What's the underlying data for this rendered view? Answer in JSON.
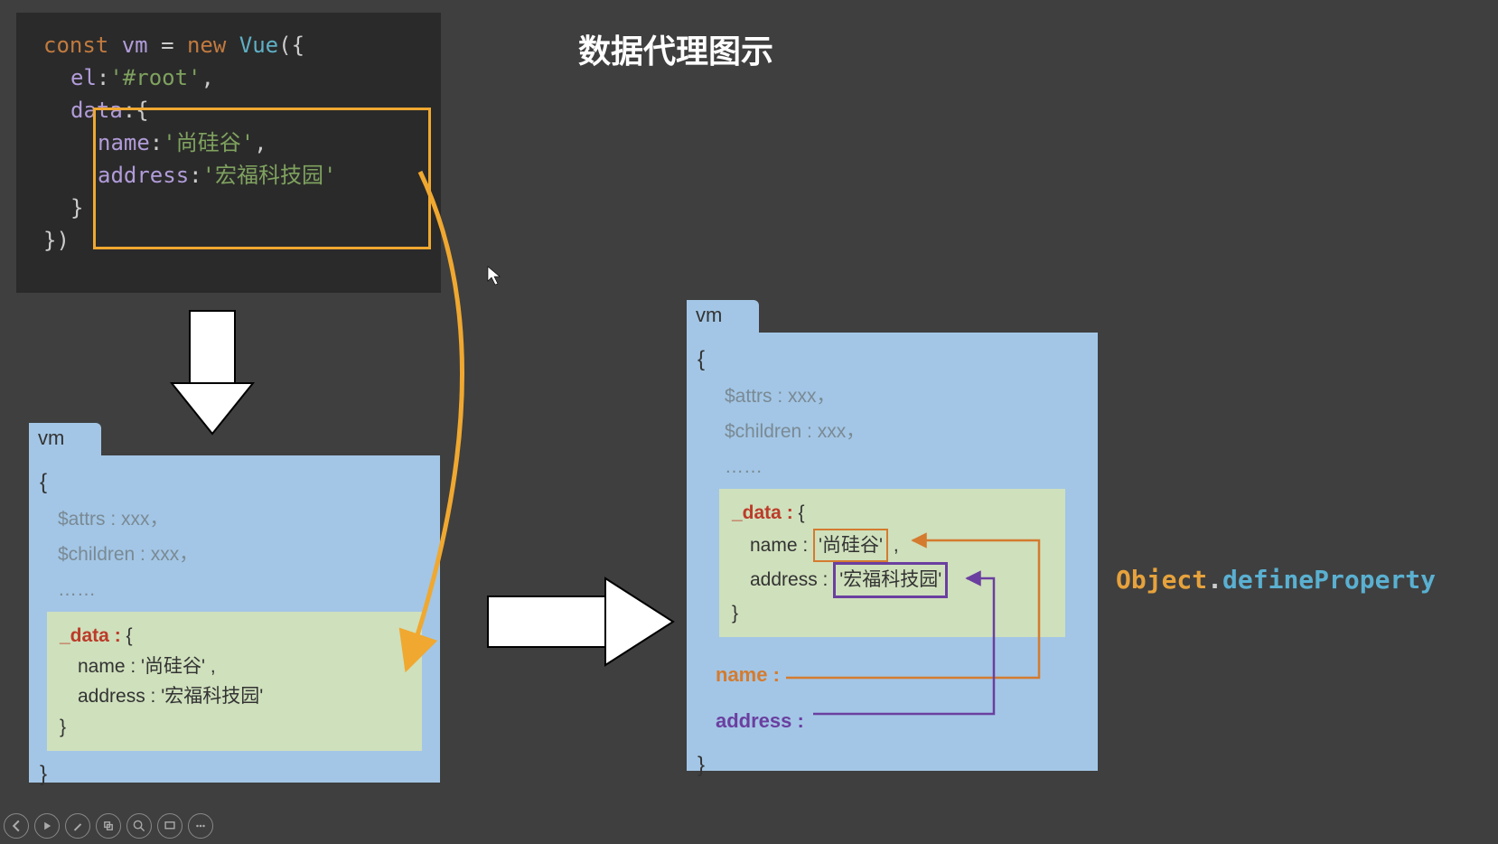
{
  "title": "数据代理图示",
  "code": {
    "line1_const": "const",
    "line1_var": "vm",
    "line1_eq": "=",
    "line1_new": "new",
    "line1_cls": "Vue",
    "line1_open": "({",
    "line2_prop": "el",
    "line2_val": "'#root'",
    "line3_prop": "data",
    "line3_open": ":{",
    "line4_prop": "name",
    "line4_val": "'尚硅谷'",
    "line5_prop": "address",
    "line5_val": "'宏福科技园'",
    "line6_close": "}",
    "line7_close": "})"
  },
  "vm": {
    "label": "vm",
    "brace_open": "{",
    "brace_close": "}",
    "attrs": "$attrs : xxx，",
    "children": "$children : xxx，",
    "dots": "……",
    "data_key": "_data :",
    "data_open": "{",
    "data_name_key": "name :",
    "data_name_val": "'尚硅谷'",
    "data_name_comma": " ,",
    "data_addr_key": "address :",
    "data_addr_val": "'宏福科技园'",
    "data_close": "}"
  },
  "proxy": {
    "name_label": "name :",
    "addr_label": "address :"
  },
  "odp": {
    "obj": "Object",
    "dot": ".",
    "method": "defineProperty"
  }
}
